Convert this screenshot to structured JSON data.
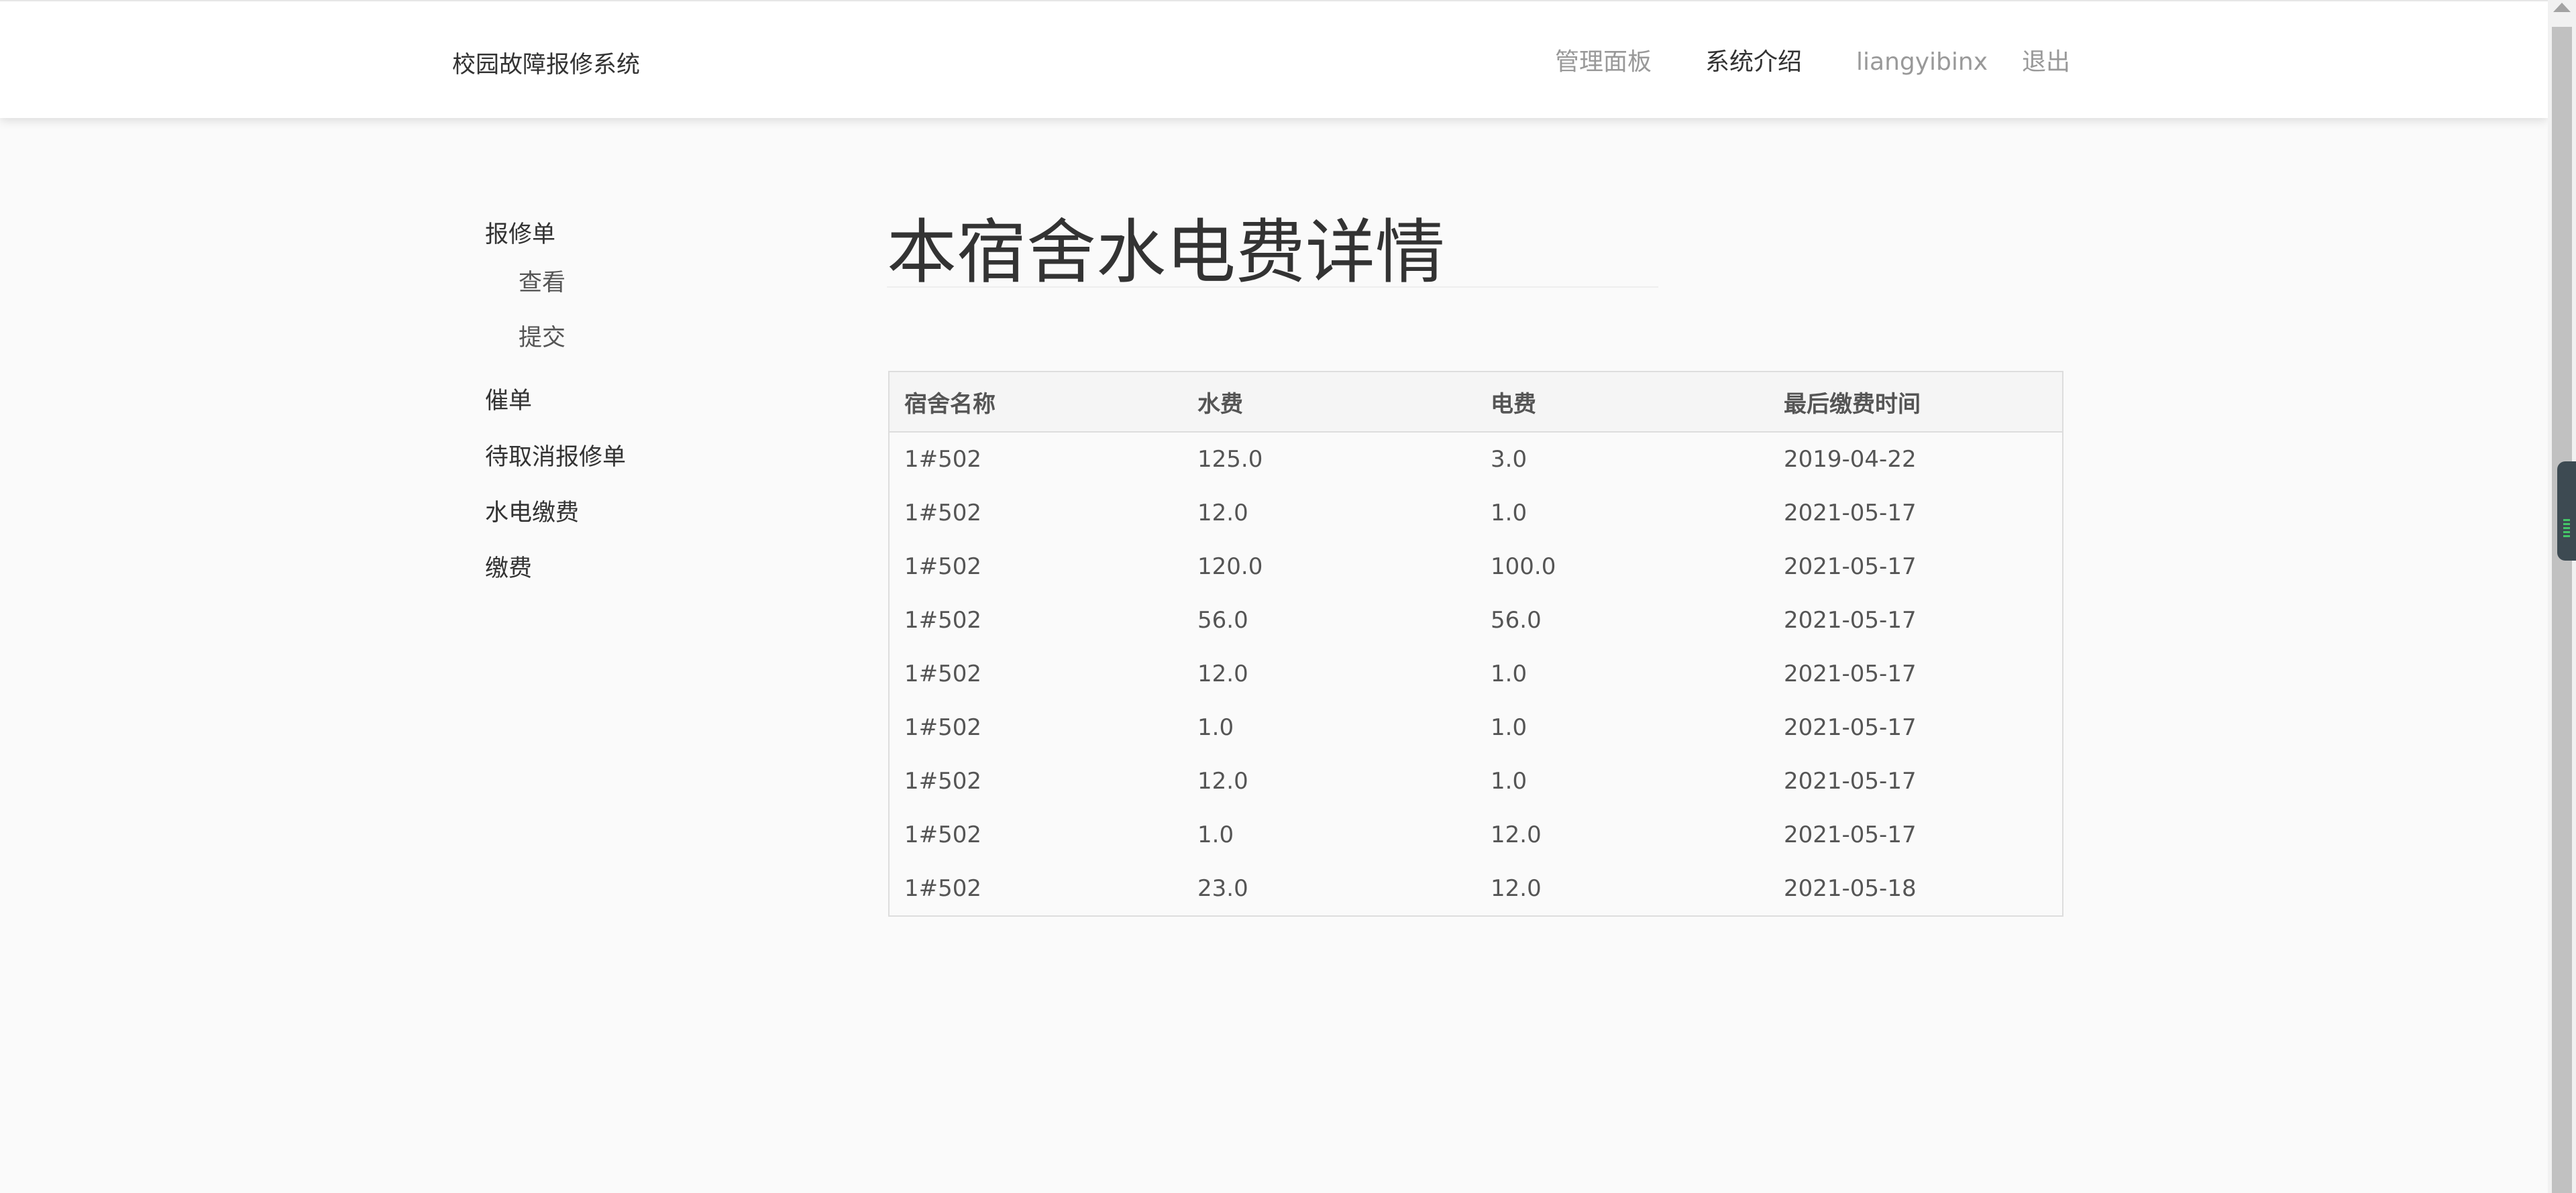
{
  "header": {
    "brand": "校园故障报修系统",
    "nav": {
      "dashboard": "管理面板",
      "about": "系统介绍",
      "username": "liangyibinx",
      "logout": "退出"
    }
  },
  "sidebar": {
    "repair_orders": "报修单",
    "view": "查看",
    "submit": "提交",
    "urge": "催单",
    "pending_cancel": "待取消报修单",
    "utility_payment": "水电缴费",
    "payment": "缴费"
  },
  "main": {
    "title": "本宿舍水电费详情",
    "table": {
      "columns": [
        "宿舍名称",
        "水费",
        "电费",
        "最后缴费时间"
      ],
      "rows": [
        [
          "1#502",
          "125.0",
          "3.0",
          "2019-04-22"
        ],
        [
          "1#502",
          "12.0",
          "1.0",
          "2021-05-17"
        ],
        [
          "1#502",
          "120.0",
          "100.0",
          "2021-05-17"
        ],
        [
          "1#502",
          "56.0",
          "56.0",
          "2021-05-17"
        ],
        [
          "1#502",
          "12.0",
          "1.0",
          "2021-05-17"
        ],
        [
          "1#502",
          "1.0",
          "1.0",
          "2021-05-17"
        ],
        [
          "1#502",
          "12.0",
          "1.0",
          "2021-05-17"
        ],
        [
          "1#502",
          "1.0",
          "12.0",
          "2021-05-17"
        ],
        [
          "1#502",
          "23.0",
          "12.0",
          "2021-05-18"
        ]
      ]
    }
  },
  "colors": {
    "page_background": "#fafafa",
    "navbar_background": "#ffffff",
    "text_primary": "#333333",
    "nav_muted": "#999999",
    "table_border": "#dddddd"
  }
}
